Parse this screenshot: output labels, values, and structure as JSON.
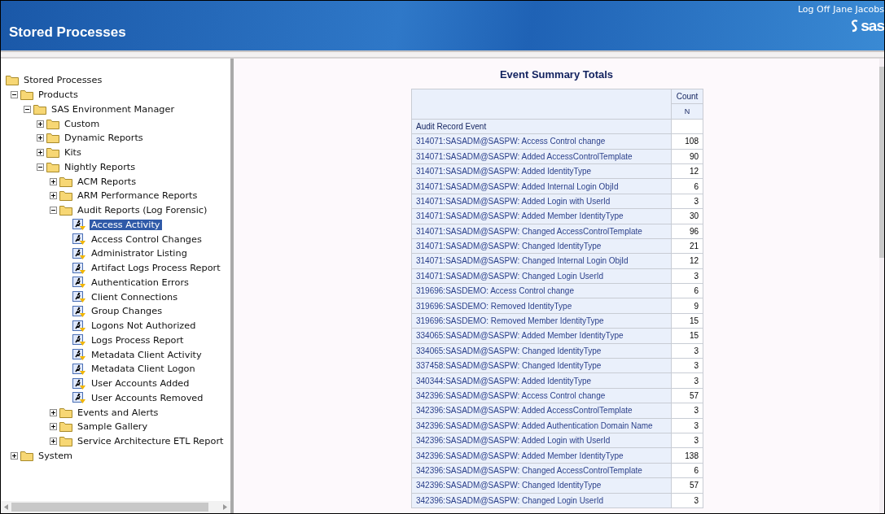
{
  "header": {
    "title": "Stored Processes",
    "log_off": "Log Off",
    "user": "Jane Jacobs",
    "logo": "sas"
  },
  "tree": {
    "root": "Stored Processes",
    "items": [
      {
        "label": "Products",
        "kind": "folder",
        "expanded": true,
        "selected": false,
        "children": [
          {
            "label": "SAS Environment Manager",
            "kind": "folder",
            "expanded": true,
            "selected": false,
            "children": [
              {
                "label": "Custom",
                "kind": "folder",
                "expanded": false,
                "selected": false
              },
              {
                "label": "Dynamic Reports",
                "kind": "folder",
                "expanded": false,
                "selected": false
              },
              {
                "label": "Kits",
                "kind": "folder",
                "expanded": false,
                "selected": false
              },
              {
                "label": "Nightly Reports",
                "kind": "folder",
                "expanded": true,
                "selected": false,
                "children": [
                  {
                    "label": "ACM Reports",
                    "kind": "folder",
                    "expanded": false,
                    "selected": false
                  },
                  {
                    "label": "ARM Performance Reports",
                    "kind": "folder",
                    "expanded": false,
                    "selected": false
                  },
                  {
                    "label": "Audit Reports (Log Forensic)",
                    "kind": "folder",
                    "expanded": true,
                    "selected": false,
                    "children": [
                      {
                        "label": "Access Activity",
                        "kind": "process",
                        "selected": true
                      },
                      {
                        "label": "Access Control Changes",
                        "kind": "process",
                        "selected": false
                      },
                      {
                        "label": "Administrator Listing",
                        "kind": "process",
                        "selected": false
                      },
                      {
                        "label": "Artifact Logs Process Report",
                        "kind": "process",
                        "selected": false
                      },
                      {
                        "label": "Authentication Errors",
                        "kind": "process",
                        "selected": false
                      },
                      {
                        "label": "Client Connections",
                        "kind": "process",
                        "selected": false
                      },
                      {
                        "label": "Group Changes",
                        "kind": "process",
                        "selected": false
                      },
                      {
                        "label": "Logons Not Authorized",
                        "kind": "process",
                        "selected": false
                      },
                      {
                        "label": "Logs Process Report",
                        "kind": "process",
                        "selected": false
                      },
                      {
                        "label": "Metadata Client Activity",
                        "kind": "process",
                        "selected": false
                      },
                      {
                        "label": "Metadata Client Logon",
                        "kind": "process",
                        "selected": false
                      },
                      {
                        "label": "User Accounts Added",
                        "kind": "process",
                        "selected": false
                      },
                      {
                        "label": "User Accounts Removed",
                        "kind": "process",
                        "selected": false
                      }
                    ]
                  },
                  {
                    "label": "Events and Alerts",
                    "kind": "folder",
                    "expanded": false,
                    "selected": false
                  },
                  {
                    "label": "Sample Gallery",
                    "kind": "folder",
                    "expanded": false,
                    "selected": false
                  },
                  {
                    "label": "Service Architecture ETL Report",
                    "kind": "folder",
                    "expanded": false,
                    "selected": false
                  }
                ]
              }
            ]
          }
        ]
      },
      {
        "label": "System",
        "kind": "folder",
        "expanded": false,
        "selected": false
      }
    ]
  },
  "report": {
    "title": "Event Summary Totals",
    "count_header": "Count",
    "stat_header": "N",
    "row_header": "Audit Record Event",
    "rows": [
      {
        "event": "314071:SASADM@SASPW: Access Control change",
        "count": "108"
      },
      {
        "event": "314071:SASADM@SASPW: Added AccessControlTemplate",
        "count": "90"
      },
      {
        "event": "314071:SASADM@SASPW: Added IdentityType",
        "count": "12"
      },
      {
        "event": "314071:SASADM@SASPW: Added Internal Login ObjId",
        "count": "6"
      },
      {
        "event": "314071:SASADM@SASPW: Added Login with UserId",
        "count": "3"
      },
      {
        "event": "314071:SASADM@SASPW: Added Member IdentityType",
        "count": "30"
      },
      {
        "event": "314071:SASADM@SASPW: Changed AccessControlTemplate",
        "count": "96"
      },
      {
        "event": "314071:SASADM@SASPW: Changed IdentityType",
        "count": "21"
      },
      {
        "event": "314071:SASADM@SASPW: Changed Internal Login ObjId",
        "count": "12"
      },
      {
        "event": "314071:SASADM@SASPW: Changed Login UserId",
        "count": "3"
      },
      {
        "event": "319696:SASDEMO: Access Control change",
        "count": "6"
      },
      {
        "event": "319696:SASDEMO: Removed IdentityType",
        "count": "9"
      },
      {
        "event": "319696:SASDEMO: Removed Member IdentityType",
        "count": "15"
      },
      {
        "event": "334065:SASADM@SASPW: Added Member IdentityType",
        "count": "15"
      },
      {
        "event": "334065:SASADM@SASPW: Changed IdentityType",
        "count": "3"
      },
      {
        "event": "337458:SASADM@SASPW: Changed IdentityType",
        "count": "3"
      },
      {
        "event": "340344:SASADM@SASPW: Added IdentityType",
        "count": "3"
      },
      {
        "event": "342396:SASADM@SASPW: Access Control change",
        "count": "57"
      },
      {
        "event": "342396:SASADM@SASPW: Added AccessControlTemplate",
        "count": "3"
      },
      {
        "event": "342396:SASADM@SASPW: Added Authentication Domain Name",
        "count": "3"
      },
      {
        "event": "342396:SASADM@SASPW: Added Login with UserId",
        "count": "3"
      },
      {
        "event": "342396:SASADM@SASPW: Added Member IdentityType",
        "count": "138"
      },
      {
        "event": "342396:SASADM@SASPW: Changed AccessControlTemplate",
        "count": "6"
      },
      {
        "event": "342396:SASADM@SASPW: Changed IdentityType",
        "count": "57"
      },
      {
        "event": "342396:SASADM@SASPW: Changed Login UserId",
        "count": "3"
      }
    ]
  }
}
